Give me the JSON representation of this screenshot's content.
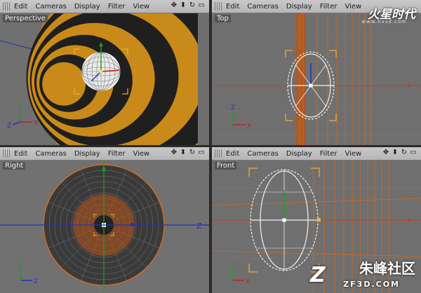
{
  "menu": [
    "Edit",
    "Cameras",
    "Display",
    "Filter",
    "View"
  ],
  "nav_icons": [
    "move-view-icon",
    "zoom-view-icon",
    "rotate-view-icon",
    "toggle-layout-icon"
  ],
  "viewports": {
    "perspective": "Perspective",
    "top": "Top",
    "right": "Right",
    "front": "Front"
  },
  "axis_labels": {
    "x": "X",
    "y": "Y",
    "z": "Z"
  },
  "watermark_top": {
    "text": "火星时代",
    "url": "www.hxsd.com"
  },
  "watermark_bottom": {
    "mark": "Z",
    "text": "朱峰社区",
    "url": "ZF3D.COM"
  },
  "colors": {
    "viewport_bg": "#6e6e6e",
    "orange": "#d66a1a",
    "selection": "#f0b030",
    "axis_red": "#c02020",
    "axis_green": "#20a020",
    "axis_blue": "#2030c0"
  }
}
